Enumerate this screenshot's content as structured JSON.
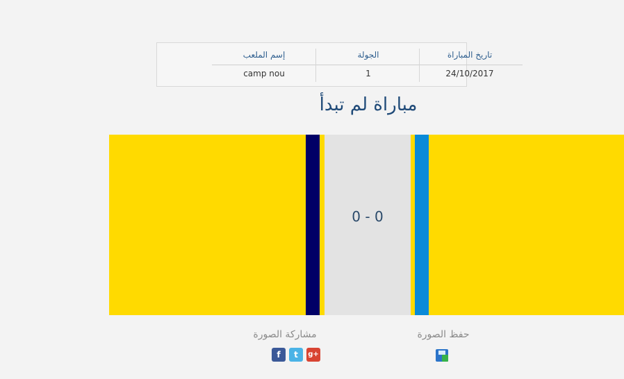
{
  "match_info": {
    "headers": {
      "date": "تاريخ المباراة",
      "round": "الجولة",
      "stadium": "إسم الملعب"
    },
    "values": {
      "date": "24/10/2017",
      "round": "1",
      "stadium": "camp nou"
    }
  },
  "title": "مباراة لم تبدأ",
  "score": "0 - 0",
  "colors": {
    "field": "#ffda00",
    "team_left": "#000066",
    "team_right": "#0a8ad8",
    "score_panel": "#e3e3e3"
  },
  "footer": {
    "share_label": "مشاركة الصورة",
    "save_label": "حفظ الصورة",
    "share_icons": [
      "facebook-icon",
      "twitter-icon",
      "google-plus-icon"
    ],
    "save_icon": "save-icon"
  }
}
